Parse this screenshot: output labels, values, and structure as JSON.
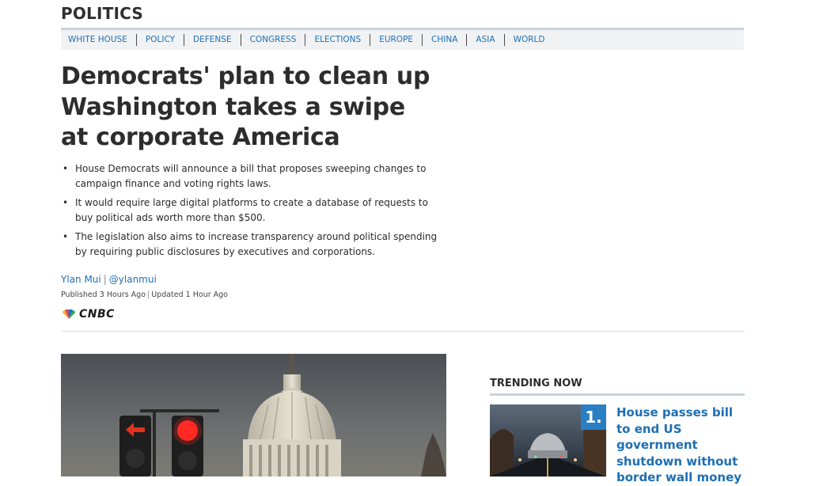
{
  "section": {
    "title": "POLITICS"
  },
  "subnav": {
    "items": [
      "WHITE HOUSE",
      "POLICY",
      "DEFENSE",
      "CONGRESS",
      "ELECTIONS",
      "EUROPE",
      "CHINA",
      "ASIA",
      "WORLD"
    ]
  },
  "article": {
    "headline": "Democrats' plan to clean up Washington takes a swipe at corporate America",
    "key_points": [
      "House Democrats will announce a bill that proposes sweeping changes to campaign finance and voting rights laws.",
      "It would require large digital platforms to create a database of requests to buy political ads worth more than $500.",
      "The legislation also aims to increase transparency around political spending by requiring public disclosures by executives and corporations."
    ],
    "author": "Ylan Mui",
    "author_handle": "@ylanmui",
    "byline_separator": "|",
    "published": "Published 3 Hours Ago",
    "updated": "Updated 1 Hour Ago",
    "source_logo": "CNBC"
  },
  "trending": {
    "title": "TRENDING NOW",
    "items": [
      {
        "rank": "1.",
        "headline": "House passes bill to end US government shutdown without border wall money"
      }
    ]
  },
  "colors": {
    "link_blue": "#1d6fb4",
    "rank_badge": "#2a7fc4",
    "subnav_bg": "#f1f2f4",
    "rule": "#c8d2dc"
  },
  "icons": {
    "logo": "nbc-peacock-icon"
  }
}
